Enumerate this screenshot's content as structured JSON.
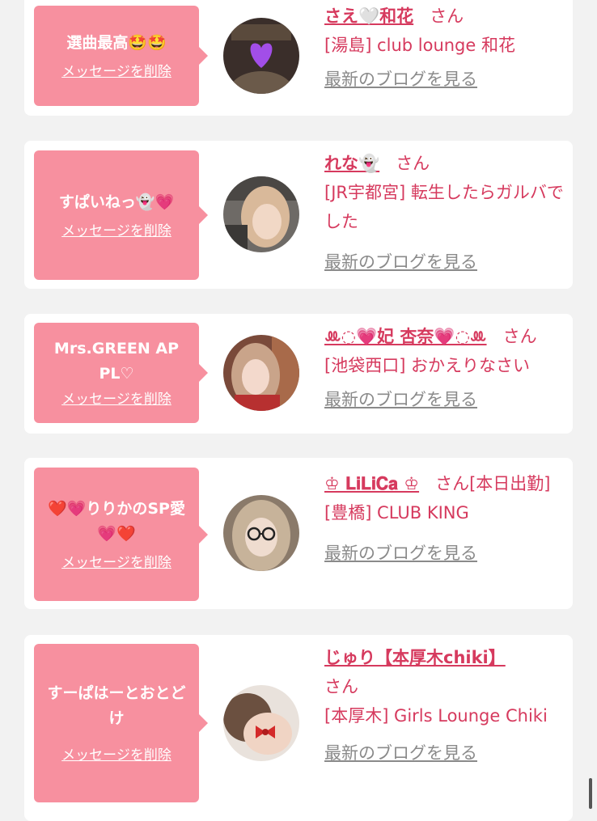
{
  "delete_label": "メッセージを削除",
  "blog_label": "最新のブログを見る",
  "san_label": "さん",
  "colors": {
    "accent": "#d63a5e",
    "bubble": "#f7909f",
    "link_gray": "#8a8a8a"
  },
  "entries": [
    {
      "message": "選曲最高🤩🤩",
      "name": "さえ🤍和花",
      "suffix": "さん",
      "shop": "[湯島] club lounge 和花",
      "avatar": "girl-photo-heart-emoji"
    },
    {
      "message": "すぱいねっ👻💗",
      "name": "れな👻",
      "suffix": "さん",
      "shop": "[JR宇都宮] 転生したらガルバでした",
      "avatar": "girl-photo-blonde"
    },
    {
      "message": "Mrs.GREEN APPL♡",
      "name": "ꔛ◌︎💗妃 杏奈💗◌︎ꔛ",
      "suffix": "さん",
      "shop": "[池袋西口] おかえりなさい",
      "avatar": "girl-photo-red-jacket"
    },
    {
      "message": "❤️💗りりかのSP愛💗❤️",
      "name": "♔ 𝐋𝐢𝐋𝐢𝐂𝐚 ♔",
      "suffix": "さん[本日出勤]",
      "shop": "[豊橋] CLUB KING",
      "avatar": "girl-photo-glasses"
    },
    {
      "message": "すーぱはーとおとどけ",
      "name": "じゅり【本厚木chiki】",
      "suffix": "さん",
      "shop": "[本厚木] Girls Lounge Chiki",
      "avatar": "girl-photo-blurred-ribbon"
    }
  ]
}
